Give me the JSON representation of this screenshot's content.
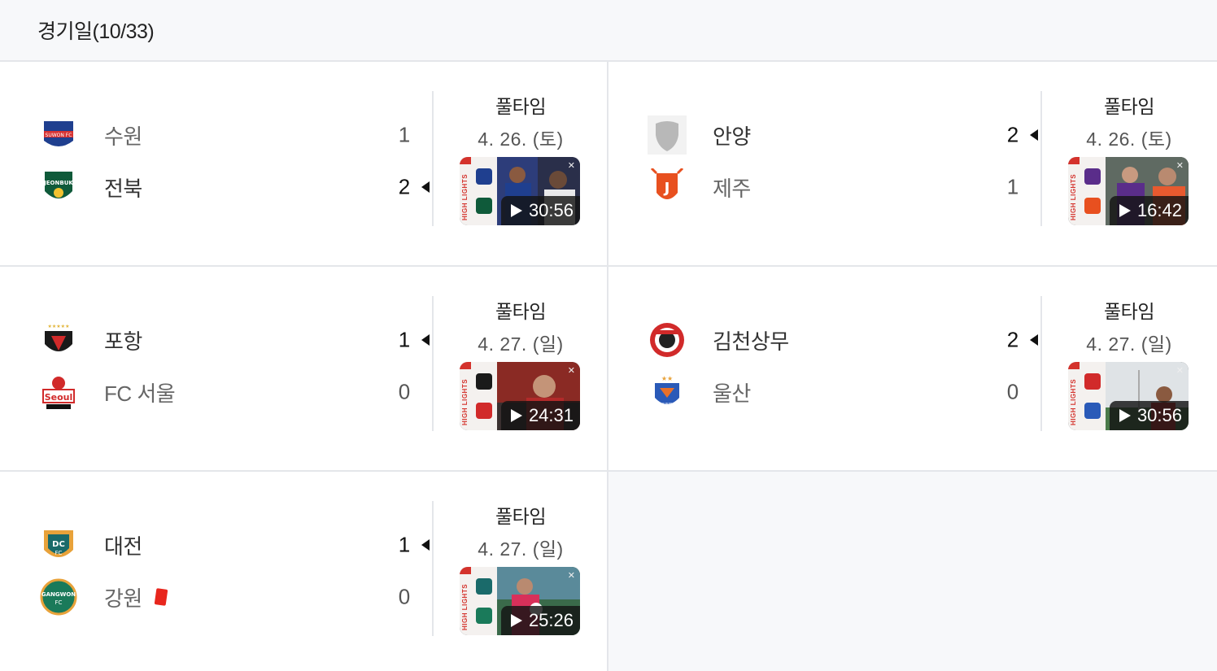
{
  "header": {
    "title": "경기일(10/33)"
  },
  "matches": [
    {
      "status": "풀타임",
      "date": "4. 26. (토)",
      "duration": "30:56",
      "home": {
        "name": "수원",
        "score": "1",
        "logo": "suwon-fc-logo",
        "winner": false,
        "red_card": false
      },
      "away": {
        "name": "전북",
        "score": "2",
        "logo": "jeonbuk-logo",
        "winner": true,
        "red_card": false
      }
    },
    {
      "status": "풀타임",
      "date": "4. 26. (토)",
      "duration": "16:42",
      "home": {
        "name": "안양",
        "score": "2",
        "logo": "anyang-shield-logo",
        "winner": true,
        "red_card": false
      },
      "away": {
        "name": "제주",
        "score": "1",
        "logo": "jeju-logo",
        "winner": false,
        "red_card": false
      }
    },
    {
      "status": "풀타임",
      "date": "4. 27. (일)",
      "duration": "24:31",
      "home": {
        "name": "포항",
        "score": "1",
        "logo": "pohang-logo",
        "winner": true,
        "red_card": false
      },
      "away": {
        "name": "FC 서울",
        "score": "0",
        "logo": "fc-seoul-logo",
        "winner": false,
        "red_card": false
      }
    },
    {
      "status": "풀타임",
      "date": "4. 27. (일)",
      "duration": "30:56",
      "home": {
        "name": "김천상무",
        "score": "2",
        "logo": "gimcheon-logo",
        "winner": true,
        "red_card": false
      },
      "away": {
        "name": "울산",
        "score": "0",
        "logo": "ulsan-logo",
        "winner": false,
        "red_card": false
      }
    },
    {
      "status": "풀타임",
      "date": "4. 27. (일)",
      "duration": "25:26",
      "home": {
        "name": "대전",
        "score": "1",
        "logo": "daejeon-logo",
        "winner": true,
        "red_card": false
      },
      "away": {
        "name": "강원",
        "score": "0",
        "logo": "gangwon-logo",
        "winner": false,
        "red_card": true
      }
    }
  ],
  "thumbnail": {
    "side_label": "HIGH LIGHTS"
  },
  "colors": {
    "accent_red": "#d4322c",
    "red_card": "#e8261d",
    "divider": "#e4e6ea"
  }
}
